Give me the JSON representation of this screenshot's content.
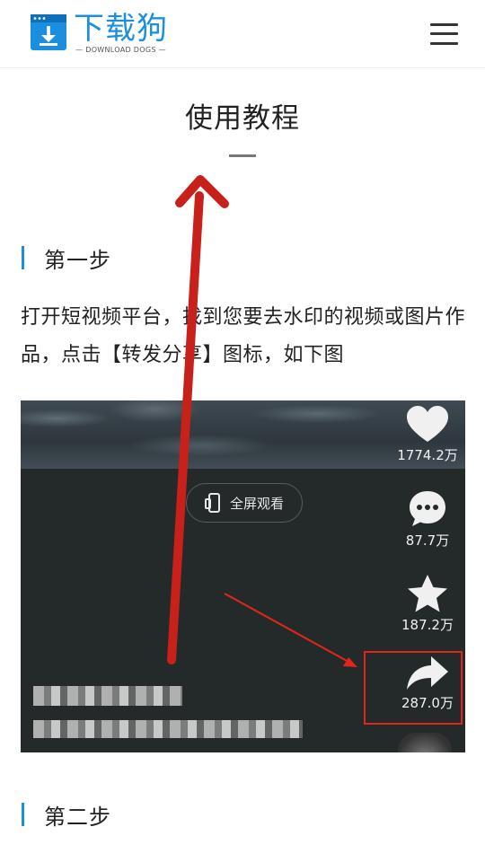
{
  "header": {
    "logo_name": "下载狗",
    "logo_subtitle": "— DOWNLOAD DOGS —",
    "brand_color": "#1a8fe0",
    "menu_icon": "hamburger-menu-icon"
  },
  "page": {
    "title": "使用教程"
  },
  "steps": [
    {
      "label": "第一步",
      "text": "打开短视频平台，找到您要去水印的视频或图片作品，点击【转发分享】图标，如下图"
    },
    {
      "label": "第二步"
    }
  ],
  "screenshot": {
    "fullscreen_label": "全屏观看",
    "actions": [
      {
        "icon": "heart-icon",
        "count": "1774.2万"
      },
      {
        "icon": "comment-icon",
        "count": "87.7万"
      },
      {
        "icon": "star-icon",
        "count": "187.2万"
      },
      {
        "icon": "share-icon",
        "count": "287.0万"
      }
    ],
    "highlight_color": "#e0261c"
  },
  "annotation_color": "#c8201a"
}
